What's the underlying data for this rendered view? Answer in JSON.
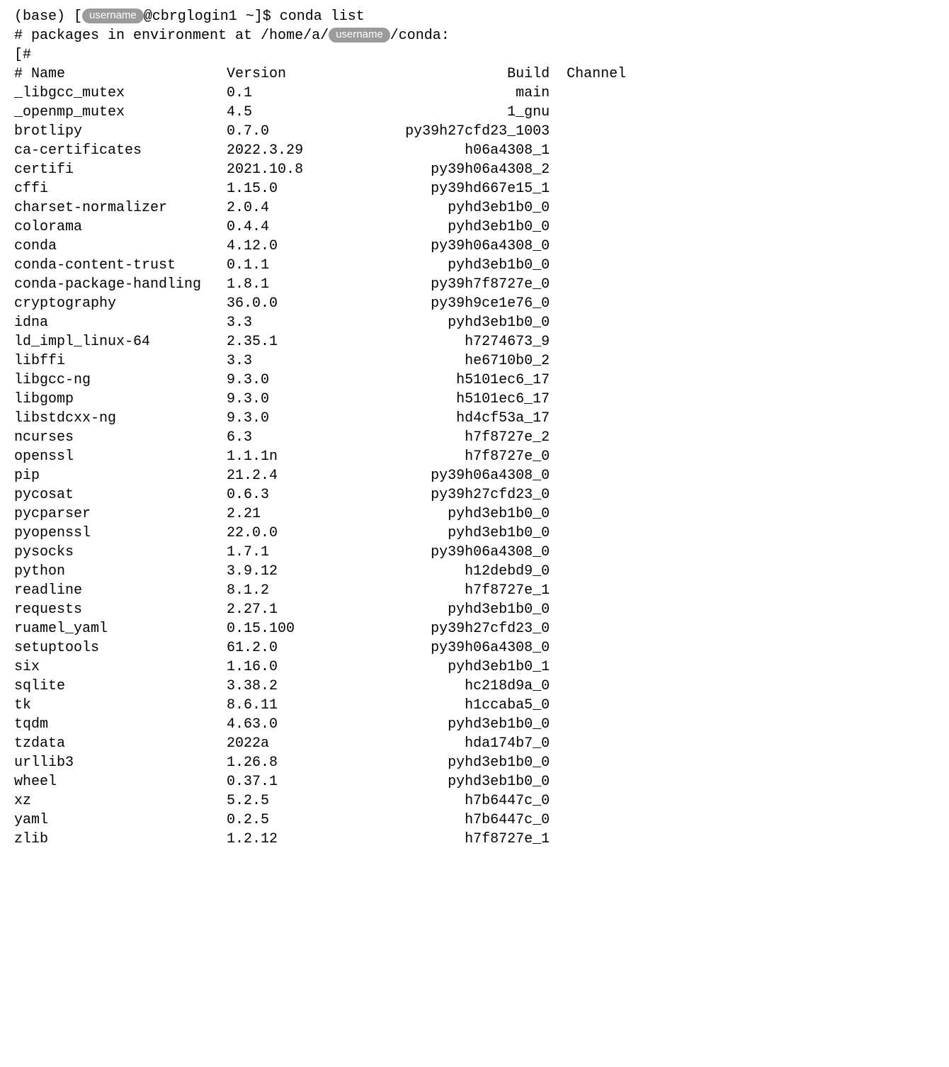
{
  "prompt": {
    "env": "(base)",
    "user_pill": "username",
    "at_host": "@cbrglogin1 ~]$ ",
    "command": "conda list"
  },
  "env_line": {
    "prefix": "# packages in environment at /home/a/",
    "user_pill": "username",
    "suffix": "/conda:"
  },
  "hash_line_1": "[#",
  "header": {
    "name": "# Name",
    "version": "Version",
    "build": "Build",
    "channel": "Channel"
  },
  "packages": [
    {
      "name": "_libgcc_mutex",
      "version": "0.1",
      "build": "main",
      "channel": ""
    },
    {
      "name": "_openmp_mutex",
      "version": "4.5",
      "build": "1_gnu",
      "channel": ""
    },
    {
      "name": "brotlipy",
      "version": "0.7.0",
      "build": "py39h27cfd23_1003",
      "channel": ""
    },
    {
      "name": "ca-certificates",
      "version": "2022.3.29",
      "build": "h06a4308_1",
      "channel": ""
    },
    {
      "name": "certifi",
      "version": "2021.10.8",
      "build": "py39h06a4308_2",
      "channel": ""
    },
    {
      "name": "cffi",
      "version": "1.15.0",
      "build": "py39hd667e15_1",
      "channel": ""
    },
    {
      "name": "charset-normalizer",
      "version": "2.0.4",
      "build": "pyhd3eb1b0_0",
      "channel": ""
    },
    {
      "name": "colorama",
      "version": "0.4.4",
      "build": "pyhd3eb1b0_0",
      "channel": ""
    },
    {
      "name": "conda",
      "version": "4.12.0",
      "build": "py39h06a4308_0",
      "channel": ""
    },
    {
      "name": "conda-content-trust",
      "version": "0.1.1",
      "build": "pyhd3eb1b0_0",
      "channel": ""
    },
    {
      "name": "conda-package-handling",
      "version": "1.8.1",
      "build": "py39h7f8727e_0",
      "channel": ""
    },
    {
      "name": "cryptography",
      "version": "36.0.0",
      "build": "py39h9ce1e76_0",
      "channel": ""
    },
    {
      "name": "idna",
      "version": "3.3",
      "build": "pyhd3eb1b0_0",
      "channel": ""
    },
    {
      "name": "ld_impl_linux-64",
      "version": "2.35.1",
      "build": "h7274673_9",
      "channel": ""
    },
    {
      "name": "libffi",
      "version": "3.3",
      "build": "he6710b0_2",
      "channel": ""
    },
    {
      "name": "libgcc-ng",
      "version": "9.3.0",
      "build": "h5101ec6_17",
      "channel": ""
    },
    {
      "name": "libgomp",
      "version": "9.3.0",
      "build": "h5101ec6_17",
      "channel": ""
    },
    {
      "name": "libstdcxx-ng",
      "version": "9.3.0",
      "build": "hd4cf53a_17",
      "channel": ""
    },
    {
      "name": "ncurses",
      "version": "6.3",
      "build": "h7f8727e_2",
      "channel": ""
    },
    {
      "name": "openssl",
      "version": "1.1.1n",
      "build": "h7f8727e_0",
      "channel": ""
    },
    {
      "name": "pip",
      "version": "21.2.4",
      "build": "py39h06a4308_0",
      "channel": ""
    },
    {
      "name": "pycosat",
      "version": "0.6.3",
      "build": "py39h27cfd23_0",
      "channel": ""
    },
    {
      "name": "pycparser",
      "version": "2.21",
      "build": "pyhd3eb1b0_0",
      "channel": ""
    },
    {
      "name": "pyopenssl",
      "version": "22.0.0",
      "build": "pyhd3eb1b0_0",
      "channel": ""
    },
    {
      "name": "pysocks",
      "version": "1.7.1",
      "build": "py39h06a4308_0",
      "channel": ""
    },
    {
      "name": "python",
      "version": "3.9.12",
      "build": "h12debd9_0",
      "channel": ""
    },
    {
      "name": "readline",
      "version": "8.1.2",
      "build": "h7f8727e_1",
      "channel": ""
    },
    {
      "name": "requests",
      "version": "2.27.1",
      "build": "pyhd3eb1b0_0",
      "channel": ""
    },
    {
      "name": "ruamel_yaml",
      "version": "0.15.100",
      "build": "py39h27cfd23_0",
      "channel": ""
    },
    {
      "name": "setuptools",
      "version": "61.2.0",
      "build": "py39h06a4308_0",
      "channel": ""
    },
    {
      "name": "six",
      "version": "1.16.0",
      "build": "pyhd3eb1b0_1",
      "channel": ""
    },
    {
      "name": "sqlite",
      "version": "3.38.2",
      "build": "hc218d9a_0",
      "channel": ""
    },
    {
      "name": "tk",
      "version": "8.6.11",
      "build": "h1ccaba5_0",
      "channel": ""
    },
    {
      "name": "tqdm",
      "version": "4.63.0",
      "build": "pyhd3eb1b0_0",
      "channel": ""
    },
    {
      "name": "tzdata",
      "version": "2022a",
      "build": "hda174b7_0",
      "channel": ""
    },
    {
      "name": "urllib3",
      "version": "1.26.8",
      "build": "pyhd3eb1b0_0",
      "channel": ""
    },
    {
      "name": "wheel",
      "version": "0.37.1",
      "build": "pyhd3eb1b0_0",
      "channel": ""
    },
    {
      "name": "xz",
      "version": "5.2.5",
      "build": "h7b6447c_0",
      "channel": ""
    },
    {
      "name": "yaml",
      "version": "0.2.5",
      "build": "h7b6447c_0",
      "channel": ""
    },
    {
      "name": "zlib",
      "version": "1.2.12",
      "build": "h7f8727e_1",
      "channel": ""
    }
  ]
}
